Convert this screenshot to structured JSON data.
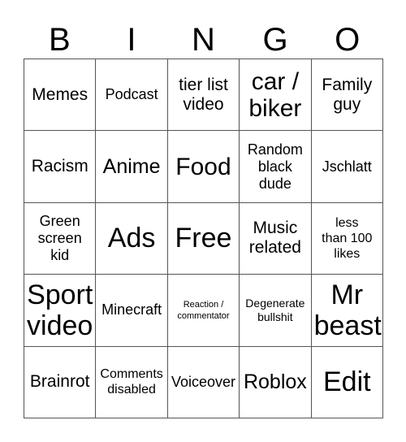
{
  "card": {
    "title": "BINGO",
    "header_letters": [
      "B",
      "I",
      "N",
      "G",
      "O"
    ],
    "rows": 5,
    "columns": 5,
    "border_color": "#555555",
    "text_color": "#000000",
    "background_color": "#ffffff",
    "cells": [
      {
        "text": "Memes",
        "size": "md",
        "row": 1,
        "col": 1
      },
      {
        "text": "Podcast",
        "size": "sm",
        "row": 1,
        "col": 2
      },
      {
        "text": "tier list\nvideo",
        "size": "md",
        "row": 1,
        "col": 3
      },
      {
        "text": "car /\nbiker",
        "size": "xl",
        "row": 1,
        "col": 4
      },
      {
        "text": "Family\nguy",
        "size": "md",
        "row": 1,
        "col": 5
      },
      {
        "text": "Racism",
        "size": "md",
        "row": 2,
        "col": 1
      },
      {
        "text": "Anime",
        "size": "lg",
        "row": 2,
        "col": 2
      },
      {
        "text": "Food",
        "size": "xl",
        "row": 2,
        "col": 3
      },
      {
        "text": "Random\nblack\ndude",
        "size": "sm",
        "row": 2,
        "col": 4
      },
      {
        "text": "Jschlatt",
        "size": "sm",
        "row": 2,
        "col": 5
      },
      {
        "text": "Green\nscreen\nkid",
        "size": "sm",
        "row": 3,
        "col": 1
      },
      {
        "text": "Ads",
        "size": "xxl",
        "row": 3,
        "col": 2
      },
      {
        "text": "Free",
        "size": "xxl",
        "row": 3,
        "col": 3
      },
      {
        "text": "Music\nrelated",
        "size": "md",
        "row": 3,
        "col": 4
      },
      {
        "text": "less\nthan 100\nlikes",
        "size": "xs",
        "row": 3,
        "col": 5
      },
      {
        "text": "Sport\nvideo",
        "size": "xxl",
        "row": 4,
        "col": 1
      },
      {
        "text": "Minecraft",
        "size": "sm",
        "row": 4,
        "col": 2
      },
      {
        "text": "Reaction /\ncommentator",
        "size": "tiny",
        "row": 4,
        "col": 3
      },
      {
        "text": "Degenerate\nbullshit",
        "size": "xxs",
        "row": 4,
        "col": 4
      },
      {
        "text": "Mr\nbeast",
        "size": "xxl",
        "row": 4,
        "col": 5
      },
      {
        "text": "Brainrot",
        "size": "md",
        "row": 5,
        "col": 1
      },
      {
        "text": "Comments\ndisabled",
        "size": "xs",
        "row": 5,
        "col": 2
      },
      {
        "text": "Voiceover",
        "size": "sm",
        "row": 5,
        "col": 3
      },
      {
        "text": "Roblox",
        "size": "lg",
        "row": 5,
        "col": 4
      },
      {
        "text": "Edit",
        "size": "xxl",
        "row": 5,
        "col": 5
      }
    ]
  }
}
